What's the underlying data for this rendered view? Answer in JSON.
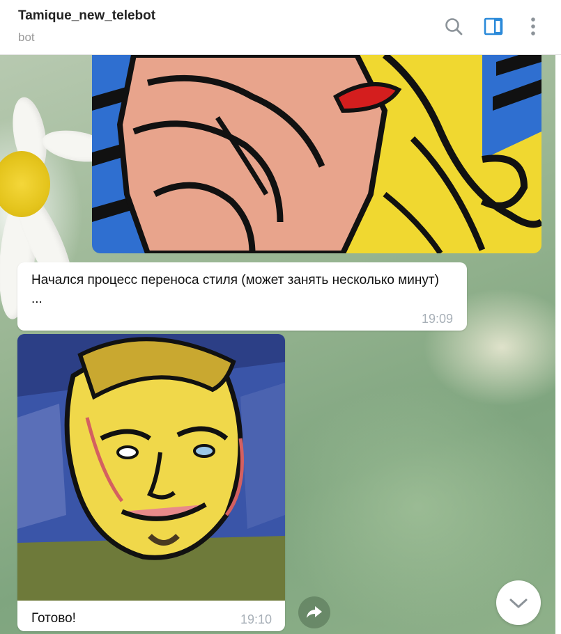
{
  "header": {
    "title": "Tamique_new_telebot",
    "subtitle": "bot"
  },
  "icons": {
    "search": "search-icon",
    "sidebar": "sidebar-toggle-icon",
    "more": "more-vertical-icon",
    "forward": "forward-icon",
    "scroll": "chevron-down-icon"
  },
  "messages": [
    {
      "type": "image",
      "description_name": "pop-art-image"
    },
    {
      "type": "text",
      "text": "Начался процесс переноса стиля (может занять несколько минут)\n...",
      "time": "19:09"
    },
    {
      "type": "image-caption",
      "caption": "Готово!",
      "time": "19:10"
    }
  ],
  "colors": {
    "accent": "#2b8ad9",
    "icon_gray": "#8c9399",
    "time_gray": "#a8b0b8"
  }
}
